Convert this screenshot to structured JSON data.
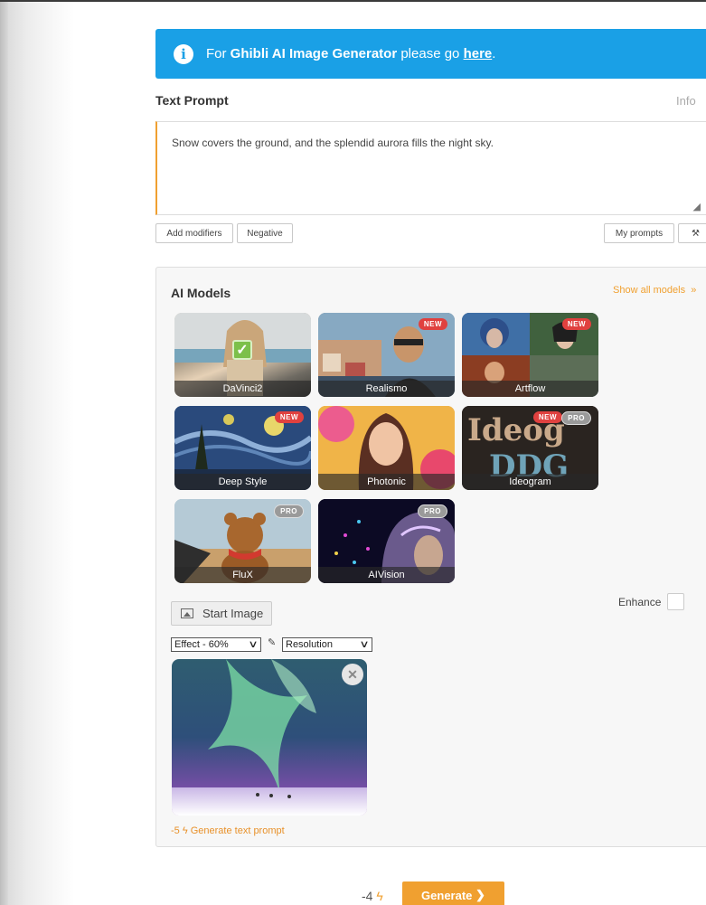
{
  "banner": {
    "prefix": "For",
    "bold": "Ghibli AI Image Generator",
    "middle": "please go",
    "link": "here",
    "suffix": "."
  },
  "prompt": {
    "label": "Text Prompt",
    "info_label": "Info",
    "value": "Snow covers the ground, and the splendid aurora fills the night sky.",
    "buttons": {
      "add_modifiers": "Add modifiers",
      "negative": "Negative",
      "my_prompts": "My prompts"
    }
  },
  "models": {
    "title": "AI Models",
    "show_all": "Show all models",
    "selected": "DaVinci2",
    "items": [
      {
        "name": "DaVinci2",
        "badges": []
      },
      {
        "name": "Realismo",
        "badges": [
          "NEW"
        ]
      },
      {
        "name": "Artflow",
        "badges": [
          "NEW"
        ]
      },
      {
        "name": "Deep Style",
        "badges": [
          "NEW"
        ]
      },
      {
        "name": "Photonic",
        "badges": []
      },
      {
        "name": "Ideogram",
        "badges": [
          "NEW",
          "PRO"
        ]
      },
      {
        "name": "FluX",
        "badges": [
          "PRO"
        ]
      },
      {
        "name": "AIVision",
        "badges": [
          "PRO"
        ]
      }
    ]
  },
  "options": {
    "enhance_label": "Enhance",
    "start_image": "Start Image",
    "effect": "Effect - 60%",
    "resolution": "Resolution",
    "generate_text_prompt": "-5",
    "generate_text_prompt_label": "Generate text prompt"
  },
  "footer": {
    "cost": "-4",
    "generate": "Generate"
  },
  "colors": {
    "banner": "#1aa0e6",
    "accent": "#f0a030",
    "badge_new": "#e0413f",
    "badge_pro": "#9a9a9a"
  }
}
